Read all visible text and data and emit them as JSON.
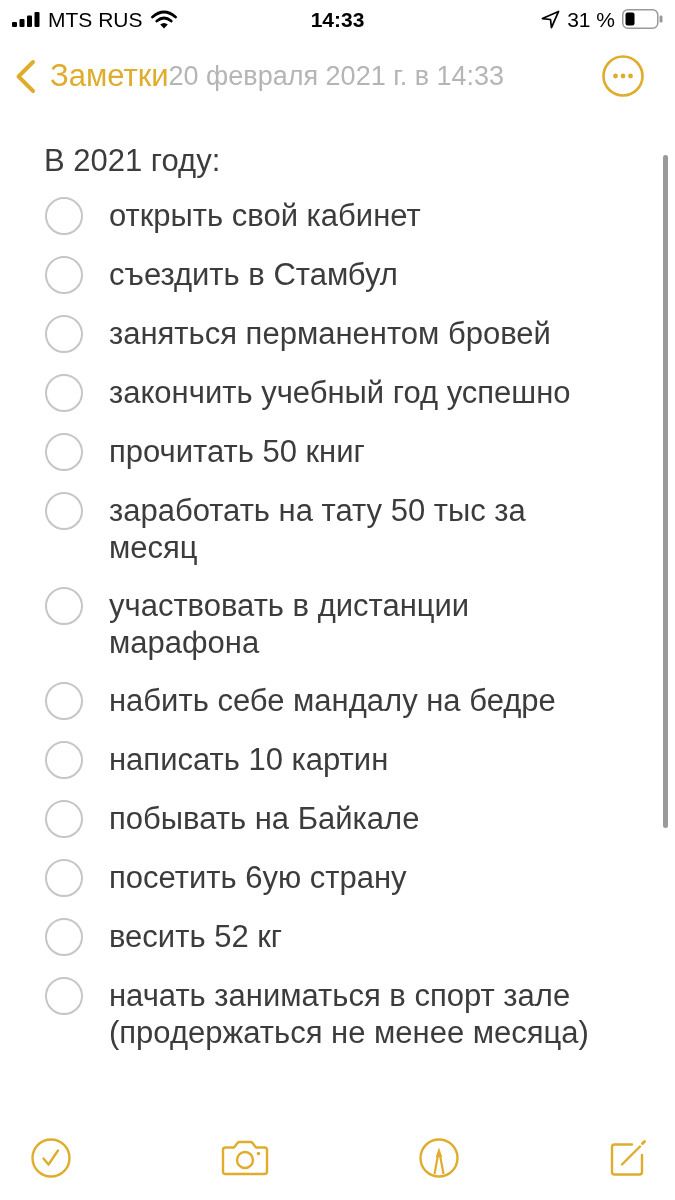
{
  "status_bar": {
    "carrier": "MTS RUS",
    "time": "14:33",
    "battery_percent": "31 %"
  },
  "nav_bar": {
    "back_label": "Заметки",
    "title": "20 февраля 2021 г. в 14:33"
  },
  "note": {
    "heading": "В 2021 году:",
    "checklist": [
      {
        "text": "открыть свой кабинет",
        "checked": false
      },
      {
        "text": "съездить в Стамбул",
        "checked": false
      },
      {
        "text": "заняться перманентом бровей",
        "checked": false
      },
      {
        "text": "закончить учебный год успешно",
        "checked": false
      },
      {
        "text": "прочитать 50 книг",
        "checked": false
      },
      {
        "text": "заработать на тату 50 тыс за месяц",
        "checked": false
      },
      {
        "text": "участвовать в дистанции марафона",
        "checked": false
      },
      {
        "text": "набить себе мандалу на бедре",
        "checked": false
      },
      {
        "text": "написать 10 картин",
        "checked": false
      },
      {
        "text": "побывать на Байкале",
        "checked": false
      },
      {
        "text": "посетить 6ую страну",
        "checked": false
      },
      {
        "text": "весить 52 кг",
        "checked": false
      },
      {
        "text": "начать заниматься в спорт зале (продержаться не менее месяца)",
        "checked": false
      }
    ]
  }
}
